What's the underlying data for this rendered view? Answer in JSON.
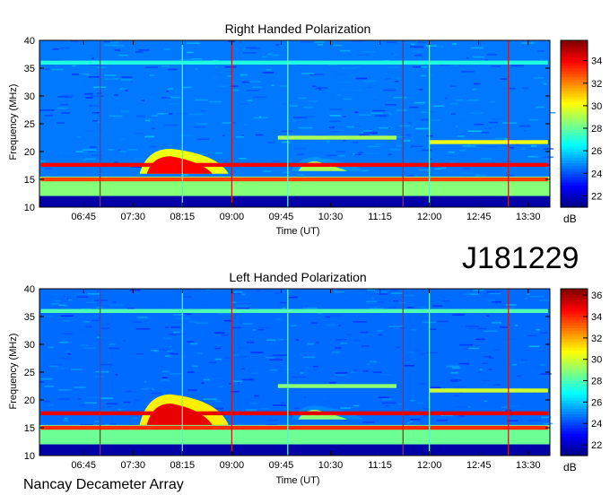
{
  "observatory": "Nancay Decameter Array",
  "date_code": "J181229",
  "chart_data": [
    {
      "type": "heatmap",
      "title": "Right Handed Polarization",
      "xlabel": "Time (UT)",
      "ylabel": "Frequency (MHz)",
      "x_ticks": [
        "06:45",
        "07:30",
        "08:15",
        "09:00",
        "09:45",
        "10:30",
        "11:15",
        "12:00",
        "12:45",
        "13:30"
      ],
      "x_range_hours": [
        6.08,
        13.83
      ],
      "y_ticks": [
        10,
        15,
        20,
        25,
        30,
        35,
        40
      ],
      "ylim": [
        10,
        40
      ],
      "colorbar": {
        "label": "dB",
        "ticks": [
          22,
          24,
          26,
          28,
          30,
          32,
          34
        ],
        "range": [
          21,
          35.8
        ]
      },
      "features": {
        "low_band_MHz": [
          12,
          15.5
        ],
        "bands": [
          {
            "freq_MHz": 17.6,
            "level_dB": 34,
            "t_hours": [
              6.1,
              13.8
            ]
          },
          {
            "freq_MHz": 15.0,
            "level_dB": 33,
            "t_hours": [
              6.1,
              13.8
            ]
          },
          {
            "freq_MHz": 21.7,
            "level_dB": 30,
            "t_hours": [
              12.0,
              13.8
            ]
          },
          {
            "freq_MHz": 22.5,
            "level_dB": 29,
            "t_hours": [
              9.7,
              11.5
            ]
          },
          {
            "freq_MHz": 36.0,
            "level_dB": 27,
            "t_hours": [
              6.1,
              13.8
            ]
          }
        ],
        "bursts": [
          {
            "t_start_hours": 7.6,
            "t_end_hours": 8.95,
            "f_low_MHz": 16,
            "f_high_MHz": 20.5,
            "peak_dB": 34
          },
          {
            "t_start_hours": 9.9,
            "t_end_hours": 11.0,
            "f_low_MHz": 16.5,
            "f_high_MHz": 19,
            "peak_dB": 29
          }
        ],
        "time_markers_hours": [
          7.0,
          8.25,
          9.0,
          9.85,
          11.6,
          12.0,
          13.2
        ]
      }
    },
    {
      "type": "heatmap",
      "title": "Left Handed Polarization",
      "xlabel": "Time (UT)",
      "ylabel": "Frequency (MHz)",
      "x_ticks": [
        "06:45",
        "07:30",
        "08:15",
        "09:00",
        "09:45",
        "10:30",
        "11:15",
        "12:00",
        "12:45",
        "13:30"
      ],
      "x_range_hours": [
        6.08,
        13.83
      ],
      "y_ticks": [
        10,
        15,
        20,
        25,
        30,
        35,
        40
      ],
      "ylim": [
        10,
        40
      ],
      "colorbar": {
        "label": "dB",
        "ticks": [
          22,
          24,
          26,
          28,
          30,
          32,
          34,
          36
        ],
        "range": [
          21,
          36.6
        ]
      },
      "features": {
        "low_band_MHz": [
          12,
          15.5
        ],
        "bands": [
          {
            "freq_MHz": 17.6,
            "level_dB": 35,
            "t_hours": [
              6.1,
              13.8
            ]
          },
          {
            "freq_MHz": 15.0,
            "level_dB": 34,
            "t_hours": [
              6.1,
              13.8
            ]
          },
          {
            "freq_MHz": 21.7,
            "level_dB": 30,
            "t_hours": [
              12.0,
              13.8
            ]
          },
          {
            "freq_MHz": 22.5,
            "level_dB": 29,
            "t_hours": [
              9.7,
              11.5
            ]
          },
          {
            "freq_MHz": 36.0,
            "level_dB": 28,
            "t_hours": [
              6.1,
              13.8
            ]
          }
        ],
        "bursts": [
          {
            "t_start_hours": 7.6,
            "t_end_hours": 8.95,
            "f_low_MHz": 15.5,
            "f_high_MHz": 21,
            "peak_dB": 35
          },
          {
            "t_start_hours": 9.9,
            "t_end_hours": 11.0,
            "f_low_MHz": 16.5,
            "f_high_MHz": 19,
            "peak_dB": 29
          }
        ],
        "time_markers_hours": [
          7.0,
          8.25,
          9.0,
          9.85,
          11.6,
          12.0,
          13.2
        ]
      }
    }
  ]
}
